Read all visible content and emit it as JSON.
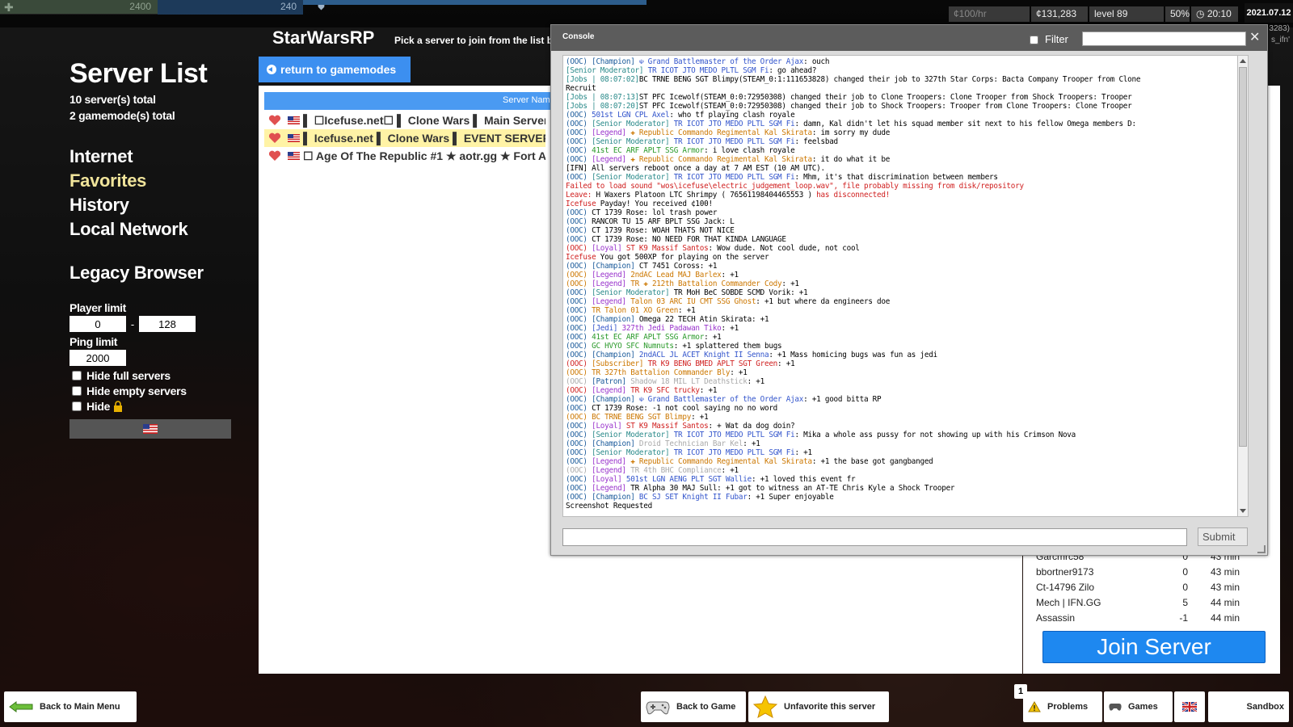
{
  "hud": {
    "health": "2400",
    "armor": "240",
    "credits_rate": "¢100/hr",
    "credits": "¢131,283",
    "level": "level 89",
    "percent": "50%",
    "time": "20:10",
    "date": "2021.07.12",
    "right_text_1": "3283)",
    "right_text_2": "s_ifn'"
  },
  "sidebar": {
    "title": "Server List",
    "servers_total": "10 server(s) total",
    "gamemodes_total": "2 gamemode(s) total",
    "nav": [
      {
        "label": "Internet"
      },
      {
        "label": "Favorites"
      },
      {
        "label": "History"
      },
      {
        "label": "Local Network"
      }
    ],
    "legacy": "Legacy Browser",
    "player_limit_label": "Player limit",
    "player_min": "0",
    "player_sep": "-",
    "player_max": "128",
    "ping_limit_label": "Ping limit",
    "ping_value": "2000",
    "hide_full": "Hide full servers",
    "hide_empty": "Hide empty servers",
    "hide_locked": "Hide"
  },
  "header": {
    "gamemode": "StarWarsRP",
    "subtitle": "Pick a server to join from the list b",
    "return_label": "return to gamemodes"
  },
  "server_list": {
    "column_name": "Server Nam",
    "rows": [
      {
        "name": "▌ ☐Icefuse.net☐ ▌ Clone Wars ▌ Main Server ▌"
      },
      {
        "name": "▌ Icefuse.net ▌ Clone Wars ▌ EVENT SERVER ▌"
      },
      {
        "name": "☐ Age Of The Republic #1 ★ aotr.gg ★ Fort Ana"
      }
    ]
  },
  "players": {
    "rows": [
      {
        "name": "Garcmrc58",
        "score": "0",
        "time": "43 min"
      },
      {
        "name": "bbortner9173",
        "score": "0",
        "time": "43 min"
      },
      {
        "name": "Ct-14796 Zilo",
        "score": "0",
        "time": "43 min"
      },
      {
        "name": "Mech | IFN.GG",
        "score": "5",
        "time": "44 min"
      },
      {
        "name": "Assassin",
        "score": "-1",
        "time": "44 min"
      }
    ],
    "join_label": "Join Server"
  },
  "console": {
    "title": "Console",
    "filter_label": "Filter",
    "submit_label": "Submit",
    "lines": [
      [
        [
          "(OOC) ",
          "ooc"
        ],
        [
          "[Champion] ",
          "tag"
        ],
        [
          "☫ Grand Battlemaster of the Order Ajax",
          "n-blue"
        ],
        [
          ": ouch",
          ""
        ]
      ],
      [
        [
          "[Senior Moderator] ",
          "n-teal"
        ],
        [
          "TR ICOT JTO MEDO PLTL SGM Fi",
          "n-blue"
        ],
        [
          ": go ahead?",
          ""
        ]
      ],
      [
        [
          "[Jobs | 08:07:02]",
          "n-teal"
        ],
        [
          "BC TRNE BENG SGT Blimpy(STEAM_0:1:111653828) changed their job to 327th Star Corps: Bacta Company Trooper from Clone",
          ""
        ]
      ],
      [
        [
          "Recruit",
          ""
        ]
      ],
      [
        [
          "[Jobs | 08:07:13]",
          "n-teal"
        ],
        [
          "ST PFC Icewolf(STEAM_0:0:72950308) changed their job to Clone Troopers: Clone Trooper from Shock Troopers: Trooper",
          ""
        ]
      ],
      [
        [
          "[Jobs | 08:07:20]",
          "n-teal"
        ],
        [
          "ST PFC Icewolf(STEAM_0:0:72950308) changed their job to Shock Troopers: Trooper from Clone Troopers: Clone Trooper",
          ""
        ]
      ],
      [
        [
          "(OOC) ",
          "ooc"
        ],
        [
          "501st LGN CPL Axel",
          "n-blue"
        ],
        [
          ": who tf playing clash royale",
          ""
        ]
      ],
      [
        [
          "(OOC) ",
          "ooc"
        ],
        [
          "[Senior Moderator] ",
          "n-teal"
        ],
        [
          "TR ICOT JTO MEDO PLTL SGM Fi",
          "n-blue"
        ],
        [
          ": damn, Kal didn't let his squad member sit next to his fellow Omega members D:",
          ""
        ]
      ],
      [
        [
          "(OOC) ",
          "ooc"
        ],
        [
          "[Legend] ",
          "n-purple"
        ],
        [
          "✚ Republic Commando Regimental Kal Skirata",
          "n-orange"
        ],
        [
          ": im sorry my dude",
          ""
        ]
      ],
      [
        [
          "(OOC) ",
          "ooc"
        ],
        [
          "[Senior Moderator] ",
          "n-teal"
        ],
        [
          "TR ICOT JTO MEDO PLTL SGM Fi",
          "n-blue"
        ],
        [
          ": feelsbad",
          ""
        ]
      ],
      [
        [
          "(OOC) ",
          "ooc"
        ],
        [
          "41st EC ARF APLT SSG Armor",
          "n-green"
        ],
        [
          ": i love clash royale",
          ""
        ]
      ],
      [
        [
          "(OOC) ",
          "ooc"
        ],
        [
          "[Legend] ",
          "n-purple"
        ],
        [
          "✚ Republic Commando Regimental Kal Skirata",
          "n-orange"
        ],
        [
          ": it do what it be",
          ""
        ]
      ],
      [
        [
          "[IFN] All servers reboot once a day at 7 AM EST (10 AM UTC).",
          ""
        ]
      ],
      [
        [
          "(OOC) ",
          "ooc"
        ],
        [
          "[Senior Moderator] ",
          "n-teal"
        ],
        [
          "TR ICOT JTO MEDO PLTL SGM Fi",
          "n-blue"
        ],
        [
          ": Mhm, it's that discrimination between members",
          ""
        ]
      ],
      [
        [
          "Failed to load sound \"wos\\icefuse\\electric_judgement_loop.wav\", file probably missing from disk/repository",
          "n-red"
        ]
      ],
      [
        [
          "Leave: ",
          "n-red"
        ],
        [
          "H Waxers Platoon LTC Shrimpy ( 76561198404465553 )",
          ""
        ],
        [
          " has disconnected!",
          "n-red"
        ]
      ],
      [
        [
          "Icefuse ",
          "n-red"
        ],
        [
          "Payday! You received ¢100!",
          ""
        ]
      ],
      [
        [
          "(OOC) ",
          "ooc"
        ],
        [
          "CT 1739 Rose: lol trash power",
          ""
        ]
      ],
      [
        [
          "(OOC) ",
          "ooc"
        ],
        [
          "RANCOR TU 15 ARF BPLT SSG Jack: L",
          ""
        ]
      ],
      [
        [
          "(OOC) ",
          "ooc"
        ],
        [
          "CT 1739 Rose: WOAH THATS NOT NICE",
          ""
        ]
      ],
      [
        [
          "(OOC) ",
          "ooc"
        ],
        [
          "CT 1739 Rose: NO NEED FOR THAT KINDA LANGUAGE",
          ""
        ]
      ],
      [
        [
          "(OOC) ",
          "n-red"
        ],
        [
          "[Loyal] ",
          "n-purple"
        ],
        [
          "ST K9 Massif Santos",
          "n-red"
        ],
        [
          ": Wow dude. Not cool dude, not cool",
          ""
        ]
      ],
      [
        [
          "Icefuse ",
          "n-red"
        ],
        [
          "You got 500XP for playing on the server",
          ""
        ]
      ],
      [
        [
          "(OOC) ",
          "ooc"
        ],
        [
          "[Champion] ",
          "tag"
        ],
        [
          "CT 7451 Coross: +1",
          ""
        ]
      ],
      [
        [
          "(OOC) ",
          "n-orange"
        ],
        [
          "[Legend] ",
          "n-purple"
        ],
        [
          "2ndAC Lead MAJ Barlex",
          "n-orange"
        ],
        [
          ": +1",
          ""
        ]
      ],
      [
        [
          "(OOC) ",
          "n-orange"
        ],
        [
          "[Legend] ",
          "n-purple"
        ],
        [
          "TR ✚ 212th Battalion Commander Cody",
          "n-orange"
        ],
        [
          ": +1",
          ""
        ]
      ],
      [
        [
          "(OOC) ",
          "ooc"
        ],
        [
          "[Senior Moderator] ",
          "n-teal"
        ],
        [
          "TR MoH BeC SOBDE SCMD Vorik: +1",
          ""
        ]
      ],
      [
        [
          "(OOC) ",
          "ooc"
        ],
        [
          "[Legend] ",
          "n-purple"
        ],
        [
          "Talon 03 ARC IU CMT SSG Ghost",
          "n-orange"
        ],
        [
          ": +1 but where da engineers doe",
          ""
        ]
      ],
      [
        [
          "(OOC) ",
          "ooc"
        ],
        [
          "TR Talon 01 XO Green",
          "n-orange"
        ],
        [
          ": +1",
          ""
        ]
      ],
      [
        [
          "(OOC) ",
          "ooc"
        ],
        [
          "[Champion] ",
          "tag"
        ],
        [
          "Omega 22 TECH Atin Skirata: +1",
          ""
        ]
      ],
      [
        [
          "(OOC) ",
          "ooc"
        ],
        [
          "[Jedi] ",
          "n-blue"
        ],
        [
          "327th Jedi Padawan Tiko",
          "n-purple"
        ],
        [
          ": +1",
          ""
        ]
      ],
      [
        [
          "(OOC) ",
          "ooc"
        ],
        [
          "41st EC ARF APLT SSG Armor",
          "n-green"
        ],
        [
          ": +1",
          ""
        ]
      ],
      [
        [
          "(OOC) ",
          "ooc"
        ],
        [
          "GC HVYO SFC Numnuts",
          "n-green"
        ],
        [
          ": +1 splattered them bugs",
          ""
        ]
      ],
      [
        [
          "(OOC) ",
          "ooc"
        ],
        [
          "[Champion] ",
          "tag"
        ],
        [
          "2ndACL JL ACET Knight II Senna",
          "n-blue"
        ],
        [
          ": +1 Mass homicing bugs was fun as jedi",
          ""
        ]
      ],
      [
        [
          "(OOC) ",
          "n-red"
        ],
        [
          "[Subscriber] ",
          "n-orange"
        ],
        [
          "TR K9 BENG BMED APLT SGT Green",
          "n-red"
        ],
        [
          ": +1",
          ""
        ]
      ],
      [
        [
          "(OOC) ",
          "n-orange"
        ],
        [
          "TR 327th Battalion Commander Bly",
          "n-orange"
        ],
        [
          ": +1",
          ""
        ]
      ],
      [
        [
          "(OOC) ",
          "n-grey"
        ],
        [
          "[Patron] ",
          "tag"
        ],
        [
          "Shadow 18 MIL LT Deathstick",
          "n-grey"
        ],
        [
          ": +1",
          ""
        ]
      ],
      [
        [
          "(OOC) ",
          "n-red"
        ],
        [
          "[Legend] ",
          "n-purple"
        ],
        [
          "TR K9 SFC trucky",
          "n-red"
        ],
        [
          ": +1",
          ""
        ]
      ],
      [
        [
          "(OOC) ",
          "ooc"
        ],
        [
          "[Champion] ",
          "tag"
        ],
        [
          "☫ Grand Battlemaster of the Order Ajax",
          "n-blue"
        ],
        [
          ": +1 good bitta RP",
          ""
        ]
      ],
      [
        [
          "(OOC) ",
          "ooc"
        ],
        [
          "CT 1739 Rose: -1 not cool saying no no word",
          ""
        ]
      ],
      [
        [
          "(OOC) ",
          "n-orange"
        ],
        [
          "BC TRNE BENG SGT Blimpy",
          "n-orange"
        ],
        [
          ": +1",
          ""
        ]
      ],
      [
        [
          "(OOC) ",
          "ooc"
        ],
        [
          "[Loyal] ",
          "n-purple"
        ],
        [
          "ST K9 Massif Santos",
          "n-red"
        ],
        [
          ": + Wat da dog doin?",
          ""
        ]
      ],
      [
        [
          "(OOC) ",
          "ooc"
        ],
        [
          "[Senior Moderator] ",
          "n-teal"
        ],
        [
          "TR ICOT JTO MEDO PLTL SGM Fi",
          "n-blue"
        ],
        [
          ": Mika a whole ass pussy for not showing up with his Crimson Nova",
          ""
        ]
      ],
      [
        [
          "(OOC) ",
          "ooc"
        ],
        [
          "[Champion] ",
          "tag"
        ],
        [
          "Droid Technician Bar Kel",
          "n-grey"
        ],
        [
          ": +1",
          ""
        ]
      ],
      [
        [
          "(OOC) ",
          "ooc"
        ],
        [
          "[Senior Moderator] ",
          "n-teal"
        ],
        [
          "TR ICOT JTO MEDO PLTL SGM Fi",
          "n-blue"
        ],
        [
          ": +1",
          ""
        ]
      ],
      [
        [
          "(OOC) ",
          "ooc"
        ],
        [
          "[Legend] ",
          "n-purple"
        ],
        [
          "✚ Republic Commando Regimental Kal Skirata",
          "n-orange"
        ],
        [
          ": +1 the base got gangbanged",
          ""
        ]
      ],
      [
        [
          "(OOC) ",
          "n-grey"
        ],
        [
          "[Legend] ",
          "n-purple"
        ],
        [
          "TR 4th BHC Compliance",
          "n-grey"
        ],
        [
          ": +1",
          ""
        ]
      ],
      [
        [
          "(OOC) ",
          "ooc"
        ],
        [
          "[Loyal] ",
          "n-purple"
        ],
        [
          "501st LGN AENG PLT SGT Wallie",
          "n-blue"
        ],
        [
          ": +1 loved this event fr",
          ""
        ]
      ],
      [
        [
          "(OOC) ",
          "ooc"
        ],
        [
          "[Legend] ",
          "n-purple"
        ],
        [
          "TR Alpha 30 MAJ Sull: +1 got to witness an AT-TE Chris Kyle a Shock Trooper",
          ""
        ]
      ],
      [
        [
          "(OOC) ",
          "ooc"
        ],
        [
          "[Champion] ",
          "tag"
        ],
        [
          "BC SJ SET Knight II Fubar",
          "n-blue"
        ],
        [
          ": +1 Super enjoyable",
          ""
        ]
      ],
      [
        [
          "Screenshot Requested",
          ""
        ]
      ]
    ]
  },
  "bottom_bar": {
    "back_main": "Back to Main Menu",
    "back_game": "Back to Game",
    "unfavorite": "Unfavorite this server",
    "problems": "Problems",
    "games": "Games",
    "sandbox": "Sandbox",
    "badge": "1"
  }
}
